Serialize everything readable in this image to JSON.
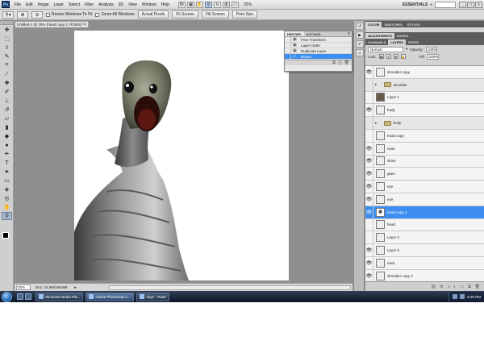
{
  "app": {
    "logo": "Ps",
    "menu": [
      "File",
      "Edit",
      "Image",
      "Layer",
      "Select",
      "Filter",
      "Analysis",
      "3D",
      "View",
      "Window",
      "Help"
    ],
    "zoom": "25%",
    "workspace": "ESSENTIALS",
    "window_controls": [
      "_",
      "□",
      "x"
    ]
  },
  "options_bar": {
    "resize_windows": "Resize Windows To Fit",
    "zoom_all_windows": "Zoom All Windows",
    "buttons": [
      "Actual Pixels",
      "Fit Screen",
      "Fill Screen",
      "Print Size"
    ]
  },
  "document": {
    "tab_title": "Untitled-1 @ 25% (head copy 2, RGB/8) *",
    "status_zoom": "25%",
    "status_doc": "Doc: 24.9M/169.9M"
  },
  "history": {
    "tabs": [
      "HISTORY",
      "ACTIONS"
    ],
    "items": [
      {
        "label": "Free Transform",
        "selected": false
      },
      {
        "label": "Layer Order",
        "selected": false
      },
      {
        "label": "Duplicate Layer",
        "selected": false
      },
      {
        "label": "Eraser",
        "selected": true
      }
    ]
  },
  "panels": {
    "top_tabs": [
      "COLOR",
      "SWATCHES",
      "STYLES"
    ],
    "mid_tabs": [
      "ADJUSTMENTS",
      "MASKS"
    ],
    "layer_tabs": [
      "CHANNELS",
      "LAYERS",
      "PATHS"
    ],
    "blend_mode": "Normal",
    "opacity_label": "Opacity:",
    "opacity": "100%",
    "lock_label": "Lock:",
    "fill_label": "Fill:",
    "fill": "100%"
  },
  "layers": [
    {
      "name": "shoulder copy",
      "visible": true,
      "group": false,
      "thumb": "trans",
      "selected": false
    },
    {
      "name": "shoulder",
      "visible": false,
      "group": true,
      "thumb": "folder",
      "selected": false
    },
    {
      "name": "Layer 1",
      "visible": false,
      "group": false,
      "thumb": "dark",
      "selected": false
    },
    {
      "name": "body",
      "visible": true,
      "group": false,
      "thumb": "trans",
      "selected": false
    },
    {
      "name": "body",
      "visible": false,
      "group": true,
      "thumb": "folder",
      "selected": false
    },
    {
      "name": "head copy",
      "visible": false,
      "group": false,
      "thumb": "trans",
      "selected": false
    },
    {
      "name": "nose",
      "visible": true,
      "group": false,
      "thumb": "trans",
      "selected": false
    },
    {
      "name": "shine",
      "visible": true,
      "group": false,
      "thumb": "trans",
      "selected": false
    },
    {
      "name": "glare",
      "visible": true,
      "group": false,
      "thumb": "trans",
      "selected": false
    },
    {
      "name": "eye",
      "visible": true,
      "group": false,
      "thumb": "trans",
      "selected": false
    },
    {
      "name": "eye",
      "visible": true,
      "group": false,
      "thumb": "trans",
      "selected": false
    },
    {
      "name": "head copy 2",
      "visible": true,
      "group": false,
      "thumb": "figure",
      "selected": true
    },
    {
      "name": "head",
      "visible": false,
      "group": false,
      "thumb": "trans",
      "selected": false
    },
    {
      "name": "Layer 2",
      "visible": false,
      "group": false,
      "thumb": "trans",
      "selected": false
    },
    {
      "name": "Layer 6",
      "visible": true,
      "group": false,
      "thumb": "trans",
      "selected": false
    },
    {
      "name": "neck",
      "visible": true,
      "group": false,
      "thumb": "trans",
      "selected": false
    },
    {
      "name": "shoulder copy 2",
      "visible": true,
      "group": false,
      "thumb": "trans",
      "selected": false
    }
  ],
  "taskbar": {
    "items": [
      {
        "label": "Windows Media Pla...",
        "active": false
      },
      {
        "label": "Adobe Photoshop C...",
        "active": true
      },
      {
        "label": "dog7 - Paint",
        "active": false
      }
    ],
    "clock": "8:20 PM"
  }
}
